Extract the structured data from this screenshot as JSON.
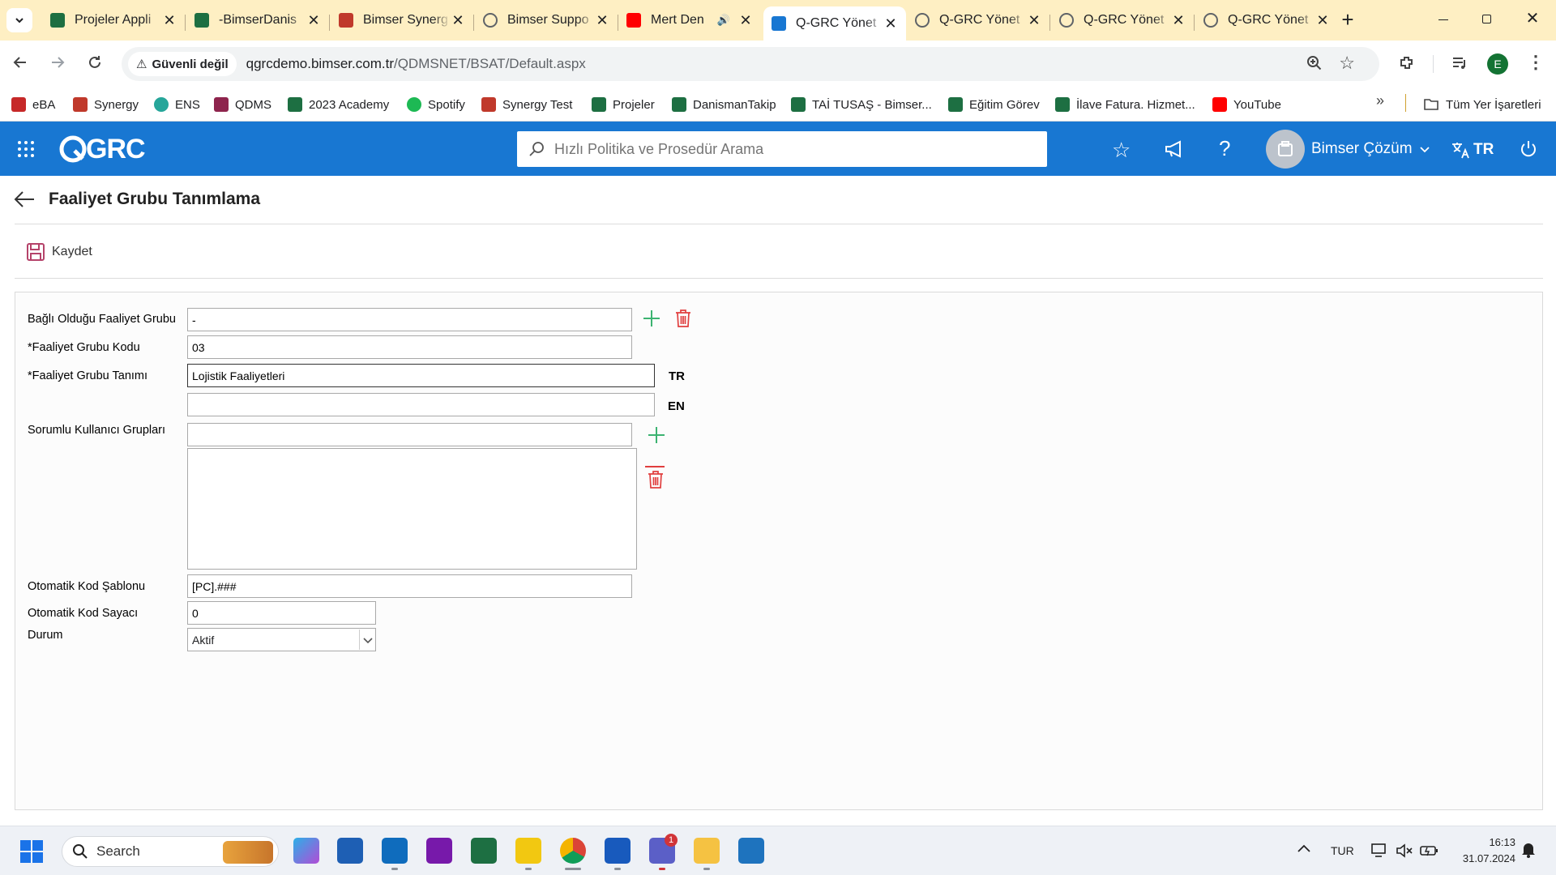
{
  "browser": {
    "tabs": [
      {
        "label": "Projeler Appli",
        "icon": "excel-icon",
        "color": "#1d6f42"
      },
      {
        "label": "-BimserDanis",
        "icon": "excel-icon",
        "color": "#1d6f42"
      },
      {
        "label": "Bimser Synerg",
        "icon": "synergy-icon",
        "color": "#c0392b"
      },
      {
        "label": "Bimser Suppo",
        "icon": "globe-icon",
        "color": "#5f6368"
      },
      {
        "label": "Mert Den",
        "icon": "youtube-icon",
        "color": "#ff0000"
      },
      {
        "label": "Q-GRC Yönet",
        "icon": "qgrc-icon",
        "color": "#1877d2"
      },
      {
        "label": "Q-GRC Yönet",
        "icon": "globe-icon",
        "color": "#5f6368"
      },
      {
        "label": "Q-GRC Yönet",
        "icon": "globe-icon",
        "color": "#5f6368"
      },
      {
        "label": "Q-GRC Yönet",
        "icon": "globe-icon",
        "color": "#5f6368"
      }
    ],
    "security_label": "Güvenli değil",
    "url_host": "qgrcdemo.bimser.com.tr",
    "url_path": "/QDMSNET/BSAT/Default.aspx",
    "profile_initial": "E",
    "bookmarks": [
      {
        "label": "eBA",
        "color": "#c62828"
      },
      {
        "label": "Synergy",
        "color": "#c0392b"
      },
      {
        "label": "ENS",
        "color": "#26a69a"
      },
      {
        "label": "QDMS",
        "color": "#8e244d"
      },
      {
        "label": "2023 Academy",
        "color": "#1d6f42"
      },
      {
        "label": "Spotify",
        "color": "#1db954"
      },
      {
        "label": "Synergy Test",
        "color": "#c0392b"
      },
      {
        "label": "Projeler",
        "color": "#1d6f42"
      },
      {
        "label": "DanismanTakip",
        "color": "#1d6f42"
      },
      {
        "label": "TAİ TUSAŞ - Bimser...",
        "color": "#1d6f42"
      },
      {
        "label": "Eğitim Görev",
        "color": "#1d6f42"
      },
      {
        "label": "İlave Fatura. Hizmet...",
        "color": "#1d6f42"
      },
      {
        "label": "YouTube",
        "color": "#ff0000"
      }
    ],
    "all_bookmarks_label": "Tüm Yer İşaretleri"
  },
  "app": {
    "logo": "QGRC",
    "search_placeholder": "Hızlı Politika ve Prosedür Arama",
    "user_name": "Bimser Çözüm",
    "language": "TR",
    "accent": "#1877d2"
  },
  "page": {
    "title": "Faaliyet Grubu Tanımlama",
    "save_label": "Kaydet",
    "form": {
      "parent_group_label": "Bağlı Olduğu Faaliyet Grubu",
      "parent_group_value": "-",
      "code_label": "*Faaliyet Grubu Kodu",
      "code_value": "03",
      "definition_label": "*Faaliyet Grubu Tanımı",
      "definition_tr_value": "Lojistik Faaliyetleri",
      "lang_tr": "TR",
      "definition_en_value": "",
      "lang_en": "EN",
      "user_groups_label": "Sorumlu Kullanıcı Grupları",
      "user_groups_value": "",
      "auto_code_template_label": "Otomatik Kod Şablonu",
      "auto_code_template_value": "[PC].###",
      "auto_code_counter_label": "Otomatik Kod Sayacı",
      "auto_code_counter_value": "0",
      "status_label": "Durum",
      "status_value": "Aktif"
    }
  },
  "taskbar": {
    "search_label": "Search",
    "language": "TUR",
    "time": "16:13",
    "date": "31.07.2024",
    "teams_badge": "1"
  }
}
